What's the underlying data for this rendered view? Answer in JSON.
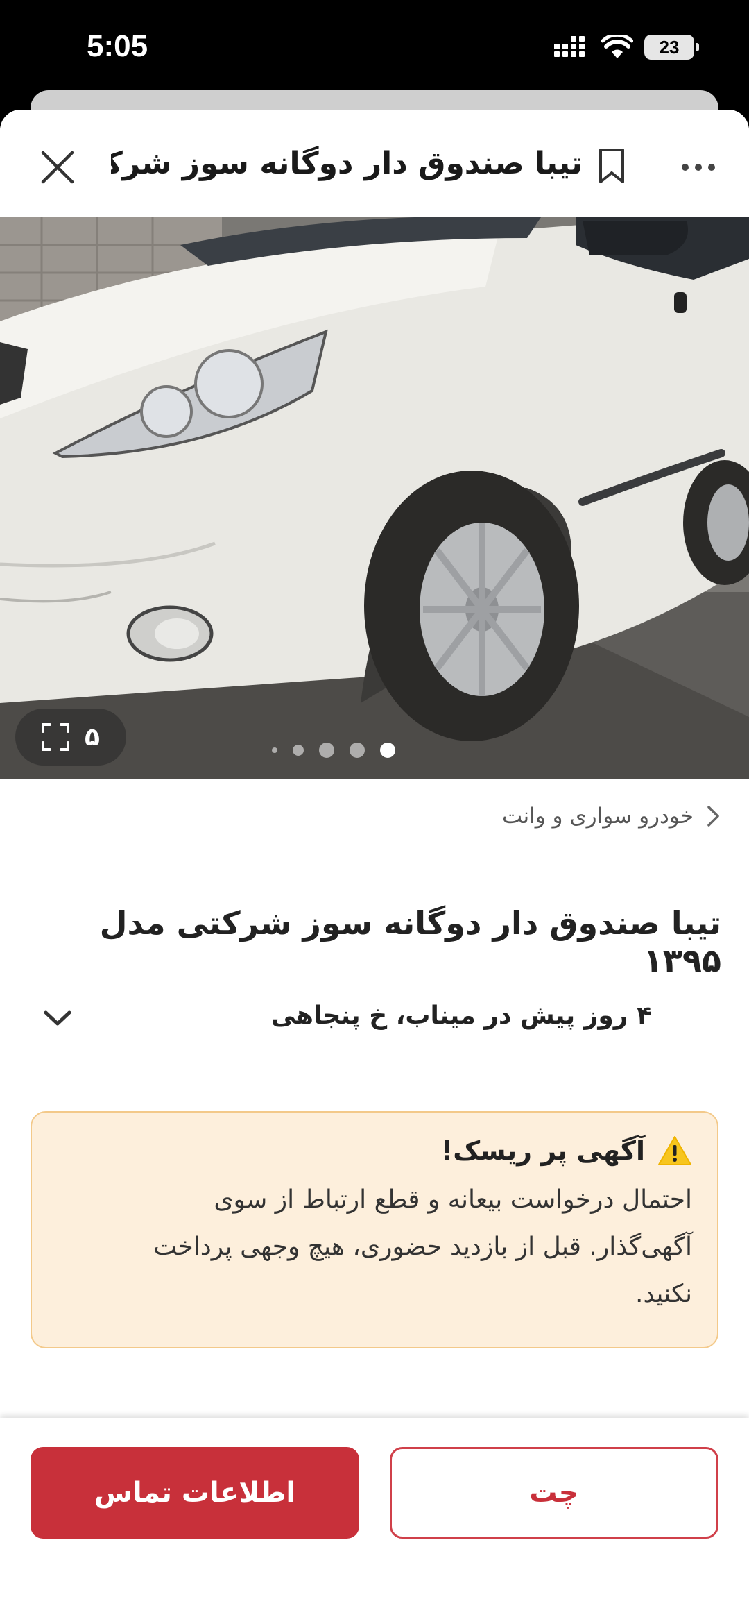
{
  "status_bar": {
    "time": "5:05",
    "battery": "23"
  },
  "header": {
    "title": "تیبا صندوق دار دوگانه سوز شرکتی..."
  },
  "gallery": {
    "photo_count": "۵",
    "total_dots": 5,
    "active_dot": 4
  },
  "breadcrumb": {
    "label": "خودرو سواری و وانت"
  },
  "listing": {
    "title": "تیبا صندوق دار دوگانه سوز شرکتی مدل ۱۳۹۵",
    "meta": "۴ روز پیش در میناب، خ پنجاهی"
  },
  "warning": {
    "title": "آگهی پر ریسک!",
    "line1": "احتمال درخواست بیعانه و قطع ارتباط از سوی",
    "line2": "آگهی‌گذار. قبل از بازدید حضوری، هیچ وجهی پرداخت",
    "line3": "نکنید."
  },
  "actions": {
    "contact_label": "اطلاعات تماس",
    "chat_label": "چت"
  },
  "colors": {
    "primary": "#c8303a",
    "warning_bg": "#fdefdc",
    "warning_border": "#f3c98a"
  }
}
